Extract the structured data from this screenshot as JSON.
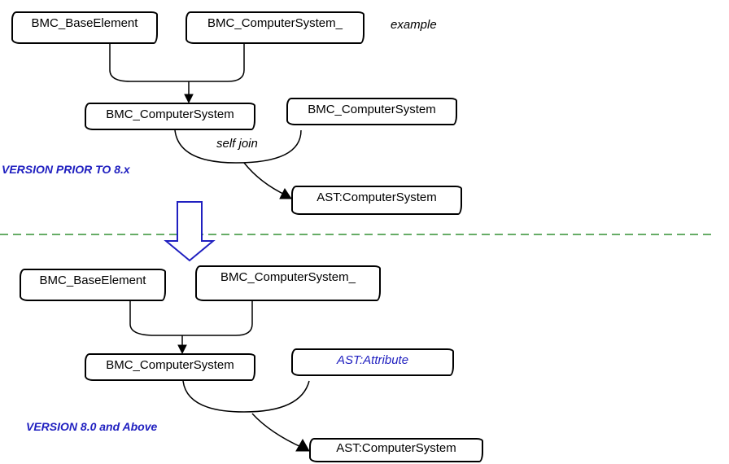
{
  "top": {
    "box_base": "BMC_BaseElement",
    "box_cs_underscore": "BMC_ComputerSystem_",
    "example_label": "example",
    "box_cs_left": "BMC_ComputerSystem",
    "box_cs_right": "BMC_ComputerSystem",
    "self_join_label": "self join",
    "box_ast_cs": "AST:ComputerSystem",
    "version_label": "VERSION PRIOR TO 8.x"
  },
  "bottom": {
    "box_base": "BMC_BaseElement",
    "box_cs_underscore": "BMC_ComputerSystem_",
    "box_cs_left": "BMC_ComputerSystem",
    "box_ast_attr": "AST:Attribute",
    "box_ast_cs": "AST:ComputerSystem",
    "version_label": "VERSION 8.0 and Above"
  }
}
